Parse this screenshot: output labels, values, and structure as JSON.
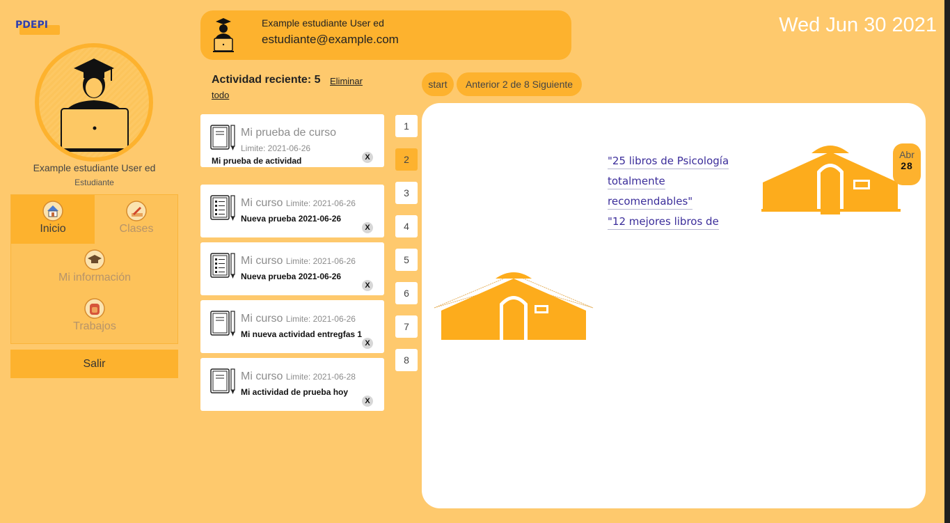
{
  "app": {
    "logo": "PDEPI"
  },
  "user": {
    "name": "Example estudiante User ed",
    "role": "Estudiante",
    "email": "estudiante@example.com"
  },
  "date": "Wed Jun 30 2021",
  "nav": {
    "inicio": "Inicio",
    "clases": "Clases",
    "info": "Mi información",
    "trabajos": "Trabajos",
    "salir": "Salir"
  },
  "activity": {
    "title": "Actividad reciente: 5",
    "clear_1": "Eliminar",
    "clear_2": "todo",
    "cards": [
      {
        "title": "Mi prueba de curso",
        "date": "Limite: 2021-06-26",
        "subtitle": "Mi prueba de actividad",
        "close": "X",
        "icon": "notebook-icon"
      },
      {
        "title": "Mi curso",
        "date": "Limite: 2021-06-26",
        "subtitle": "Nueva prueba 2021-06-26",
        "close": "X",
        "icon": "checklist-icon"
      },
      {
        "title": "Mi curso",
        "date": "Limite: 2021-06-26",
        "subtitle": "Nueva prueba 2021-06-26",
        "close": "X",
        "icon": "checklist-icon"
      },
      {
        "title": "Mi curso",
        "date": "Limite: 2021-06-26",
        "subtitle": "Mi nueva actividad entregfas 1",
        "close": "X",
        "icon": "notebook-icon"
      },
      {
        "title": "Mi curso",
        "date": "Limite: 2021-06-28",
        "subtitle": "Mi actividad de prueba hoy",
        "close": "X",
        "icon": "notebook-icon"
      }
    ]
  },
  "pagination": {
    "numbers": [
      "1",
      "2",
      "3",
      "4",
      "5",
      "6",
      "7",
      "8"
    ],
    "active": "2",
    "start": "start",
    "nav": "Anterior 2 de 8 Siguiente"
  },
  "panel": {
    "links": [
      "\"25 libros de Psicología",
      "totalmente",
      "recomendables\"",
      "\"12 mejores libros de"
    ],
    "badge_month": "Abr",
    "badge_day": "28"
  },
  "colors": {
    "background": "#fec96d",
    "accent": "#fdb22e",
    "link": "#3b2d9a"
  }
}
